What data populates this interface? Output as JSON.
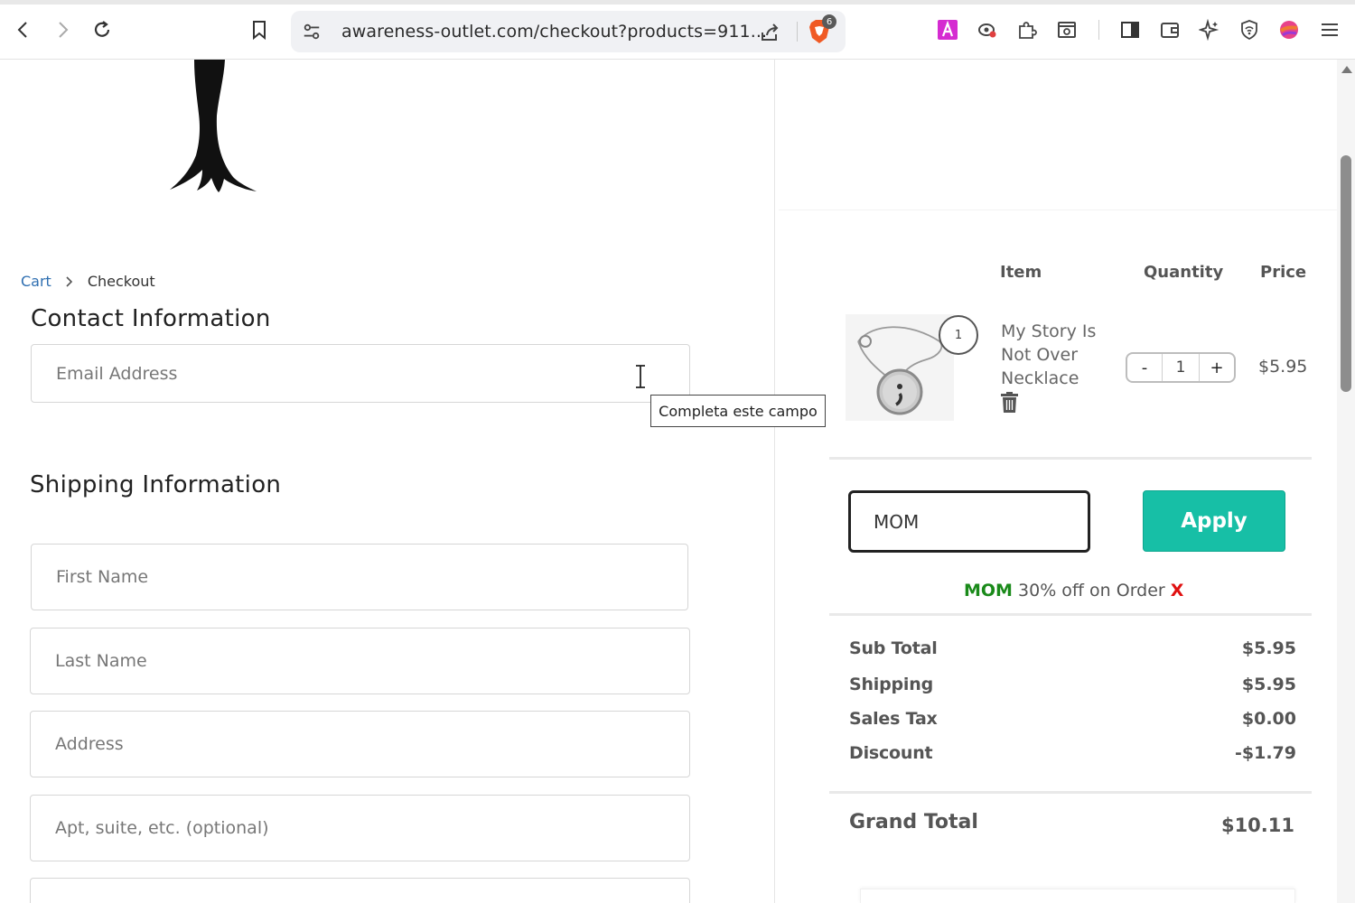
{
  "browser": {
    "url": "awareness-outlet.com/checkout?products=911...",
    "shield_count": "6"
  },
  "breadcrumb": {
    "cart": "Cart",
    "current": "Checkout"
  },
  "contact": {
    "title": "Contact Information",
    "email_placeholder": "Email Address",
    "tooltip": "Completa este campo"
  },
  "shipping": {
    "title": "Shipping Information",
    "first_name_placeholder": "First Name",
    "last_name_placeholder": "Last Name",
    "address_placeholder": "Address",
    "apt_placeholder": "Apt, suite, etc. (optional)"
  },
  "cart": {
    "headers": {
      "item": "Item",
      "quantity": "Quantity",
      "price": "Price"
    },
    "items": [
      {
        "name": "My Story Is Not Over Necklace",
        "badge": "1",
        "quantity": "1",
        "price": "$5.95",
        "minus": "-",
        "plus": "+"
      }
    ]
  },
  "coupon": {
    "value": "MOM",
    "apply_label": "Apply",
    "applied_code": "MOM",
    "applied_desc": "30% off on Order",
    "remove": "X"
  },
  "summary": {
    "subtotal_label": "Sub Total",
    "subtotal": "$5.95",
    "shipping_label": "Shipping",
    "shipping": "$5.95",
    "tax_label": "Sales Tax",
    "tax": "$0.00",
    "discount_label": "Discount",
    "discount": "-$1.79",
    "grand_label": "Grand Total",
    "grand": "$10.11"
  },
  "colors": {
    "accent": "#17bfa6",
    "link": "#2f6fb1",
    "coupon_code": "#1a8a1a",
    "remove": "#e01010"
  }
}
